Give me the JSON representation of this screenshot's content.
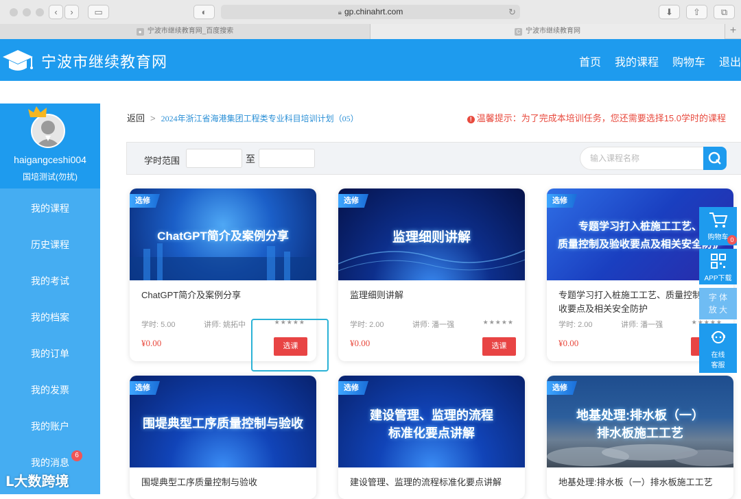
{
  "browser": {
    "url": "gp.chinahrt.com",
    "tabs": [
      "宁波市继续教育网_百度搜索",
      "宁波市继续教育网"
    ]
  },
  "header": {
    "site_title": "宁波市继续教育网",
    "nav": [
      "首页",
      "我的课程",
      "购物车",
      "退出"
    ]
  },
  "profile": {
    "username": "haigangceshi004",
    "tag": "国培测试(勿扰)"
  },
  "sidebar": {
    "items": [
      {
        "label": "我的课程"
      },
      {
        "label": "历史课程"
      },
      {
        "label": "我的考试"
      },
      {
        "label": "我的档案"
      },
      {
        "label": "我的订单"
      },
      {
        "label": "我的发票"
      },
      {
        "label": "我的账户"
      },
      {
        "label": "我的消息",
        "badge": "6"
      }
    ]
  },
  "breadcrumb": {
    "back": "返回",
    "sep": ">",
    "plan": "2024年浙江省海港集团工程类专业科目培训计划（05）"
  },
  "tip": {
    "icon": "!",
    "text": "温馨提示：为了完成本培训任务，您还需要选择15.0学时的课程"
  },
  "filter": {
    "range_label": "学时范围",
    "to_label": "至",
    "search_placeholder": "输入课程名称"
  },
  "courses": [
    {
      "tag": "选修",
      "banner": "ChatGPT简介及案例分享",
      "title": "ChatGPT简介及案例分享",
      "hours": "学时: 5.00",
      "teacher": "讲师: 姚拓中",
      "stars": "★★★★★",
      "price": "¥0.00",
      "button": "选课"
    },
    {
      "tag": "选修",
      "banner": "监理细则讲解",
      "title": "监理细则讲解",
      "hours": "学时: 2.00",
      "teacher": "讲师: 潘一强",
      "stars": "★★★★★",
      "price": "¥0.00",
      "button": "选课"
    },
    {
      "tag": "选修",
      "banner_l1": "专题学习打入桩施工工艺、",
      "banner_l2": "质量控制及验收要点及相关安全防护",
      "title": "专题学习打入桩施工工艺、质量控制及验收要点及相关安全防护",
      "hours": "学时: 2.00",
      "teacher": "讲师: 潘一强",
      "stars": "★★★★★",
      "price": "¥0.00",
      "button": "选课"
    },
    {
      "tag": "选修",
      "banner": "围堤典型工序质量控制与验收",
      "title": "围堤典型工序质量控制与验收"
    },
    {
      "tag": "选修",
      "banner_l1": "建设管理、监理的流程",
      "banner_l2": "标准化要点讲解",
      "title": "建设管理、监理的流程标准化要点讲解"
    },
    {
      "tag": "选修",
      "banner_l1": "地基处理:排水板（一）",
      "banner_l2": "排水板施工工艺",
      "title": "地基处理:排水板（一）排水板施工工艺"
    }
  ],
  "float_bar": {
    "cart": "购物车",
    "cart_badge": "0",
    "app": "APP下载",
    "font_l1": "字 体",
    "font_l2": "放 大",
    "service_l1": "在线",
    "service_l2": "客服"
  },
  "watermark": "大数跨境"
}
